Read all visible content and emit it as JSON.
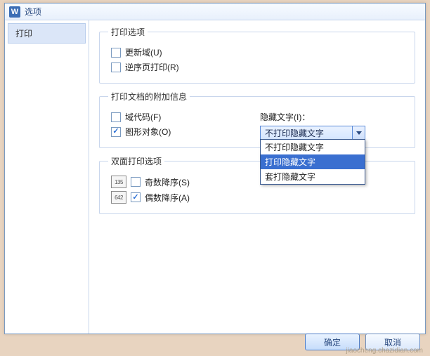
{
  "window": {
    "title": "选项"
  },
  "sidebar": {
    "items": [
      "打印"
    ]
  },
  "groups": {
    "print_options": {
      "legend": "打印选项",
      "update_fields": "更新域(U)",
      "reverse_pages": "逆序页打印(R)"
    },
    "doc_info": {
      "legend": "打印文档的附加信息",
      "field_codes": "域代码(F)",
      "drawings": "图形对象(O)",
      "hidden_label": "隐藏文字(I)：",
      "hidden_value": "不打印隐藏文字",
      "hidden_options": [
        "不打印隐藏文字",
        "打印隐藏文字",
        "套打隐藏文字"
      ],
      "hidden_highlight_index": 1
    },
    "duplex": {
      "legend": "双面打印选项",
      "odd_desc": "奇数降序(S)",
      "even_desc": "偶数降序(A)",
      "odd_icon": "135",
      "even_icon": "642"
    }
  },
  "checks": {
    "update_fields": false,
    "reverse_pages": false,
    "field_codes": false,
    "drawings": true,
    "odd_desc": false,
    "even_desc": true
  },
  "buttons": {
    "ok": "确定",
    "cancel": "取消"
  },
  "watermark": "jiaocheng.chazidian.com"
}
